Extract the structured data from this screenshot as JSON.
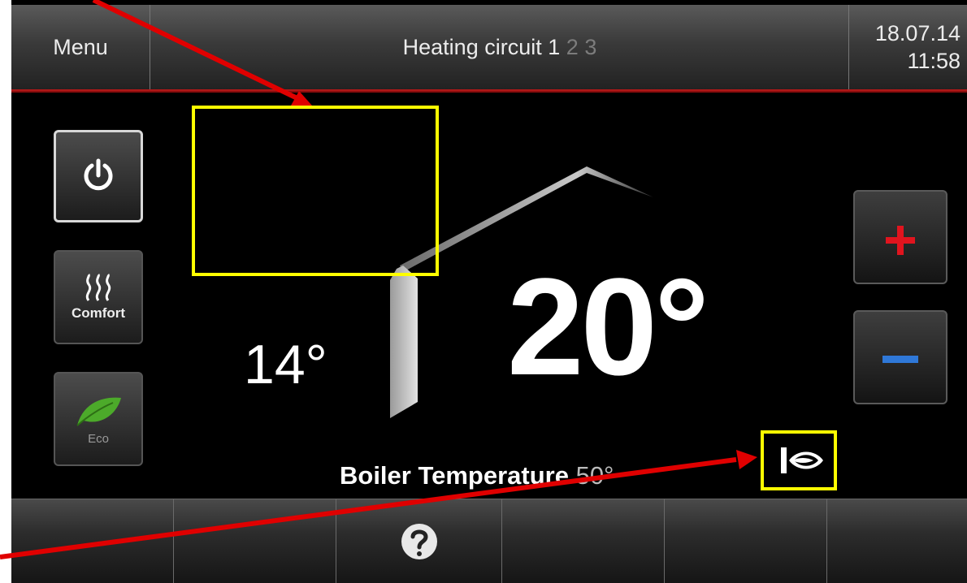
{
  "topbar": {
    "menu_label": "Menu",
    "title_text": "Heating circuit",
    "circuit_active": "1",
    "circuit_2": "2",
    "circuit_3": "3",
    "date": "18.07.14",
    "time": "11:58"
  },
  "modes": {
    "power_icon": "power-icon",
    "comfort_label": "Comfort",
    "eco_label": "Eco"
  },
  "temps": {
    "outside": "14°",
    "setpoint": "20°"
  },
  "boiler": {
    "label": "Boiler Temperature",
    "value": "50°"
  },
  "bottom_bar": {
    "help_icon": "question-icon"
  },
  "colors": {
    "accent_red": "#e0141e",
    "accent_blue": "#2f78d8",
    "annotation_yellow": "#ffff00",
    "annotation_arrow": "#e00000",
    "eco_green": "#4caa2a"
  }
}
